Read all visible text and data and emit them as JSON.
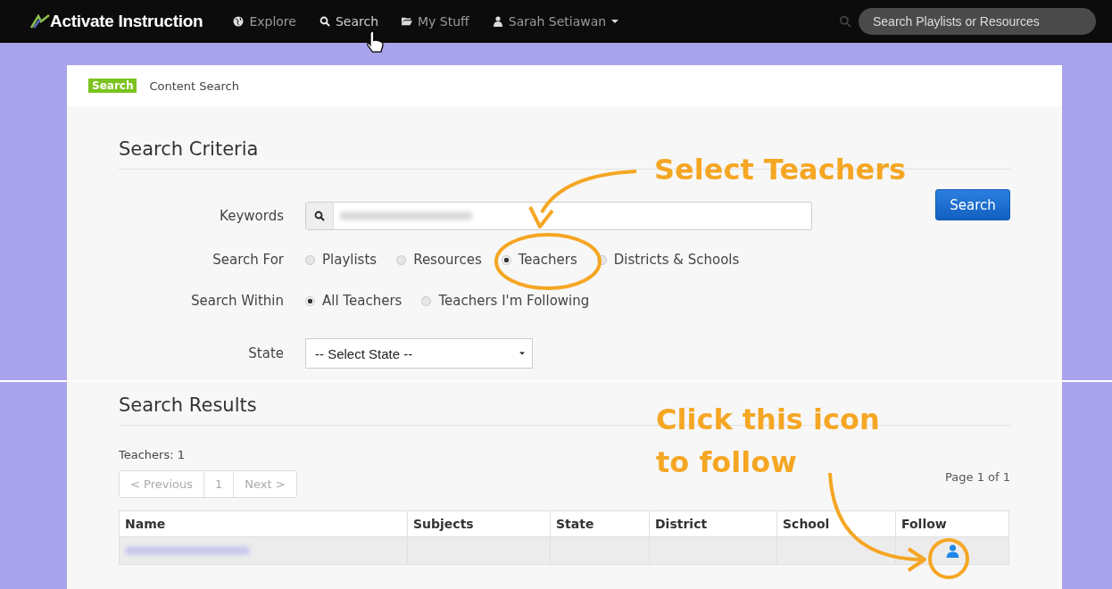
{
  "nav": {
    "brand": "Activate Instruction",
    "items": [
      {
        "label": "Explore",
        "selected": false
      },
      {
        "label": "Search",
        "selected": true
      },
      {
        "label": "My Stuff",
        "selected": false
      }
    ],
    "user": "Sarah Setiawan",
    "search": {
      "placeholder": "Search Playlists or Resources"
    }
  },
  "breadcrumb": {
    "badge": "Search",
    "title": "Content Search"
  },
  "criteria": {
    "heading": "Search Criteria",
    "keywords_label": "Keywords",
    "search_button": "Search",
    "search_for": {
      "label": "Search For",
      "options": [
        {
          "label": "Playlists",
          "selected": false
        },
        {
          "label": "Resources",
          "selected": false
        },
        {
          "label": "Teachers",
          "selected": true
        },
        {
          "label": "Districts & Schools",
          "selected": false
        }
      ]
    },
    "search_within": {
      "label": "Search Within",
      "options": [
        {
          "label": "All Teachers",
          "selected": true
        },
        {
          "label": "Teachers I'm Following",
          "selected": false
        }
      ]
    },
    "state": {
      "label": "State",
      "value": "-- Select State --"
    }
  },
  "results": {
    "heading": "Search Results",
    "count": "Teachers: 1",
    "pager": [
      {
        "label": "< Previous"
      },
      {
        "label": "1"
      },
      {
        "label": "Next >"
      }
    ],
    "page_info": "Page 1 of 1",
    "columns": [
      "Name",
      "Subjects",
      "State",
      "District",
      "School",
      "Follow"
    ],
    "rows": [
      {
        "follow_icon": true
      }
    ]
  },
  "annotations": [
    {
      "kind": "teachers",
      "lines": [
        "Select Teachers"
      ]
    },
    {
      "kind": "follow",
      "lines": [
        "Click this icon",
        "to follow"
      ]
    }
  ]
}
